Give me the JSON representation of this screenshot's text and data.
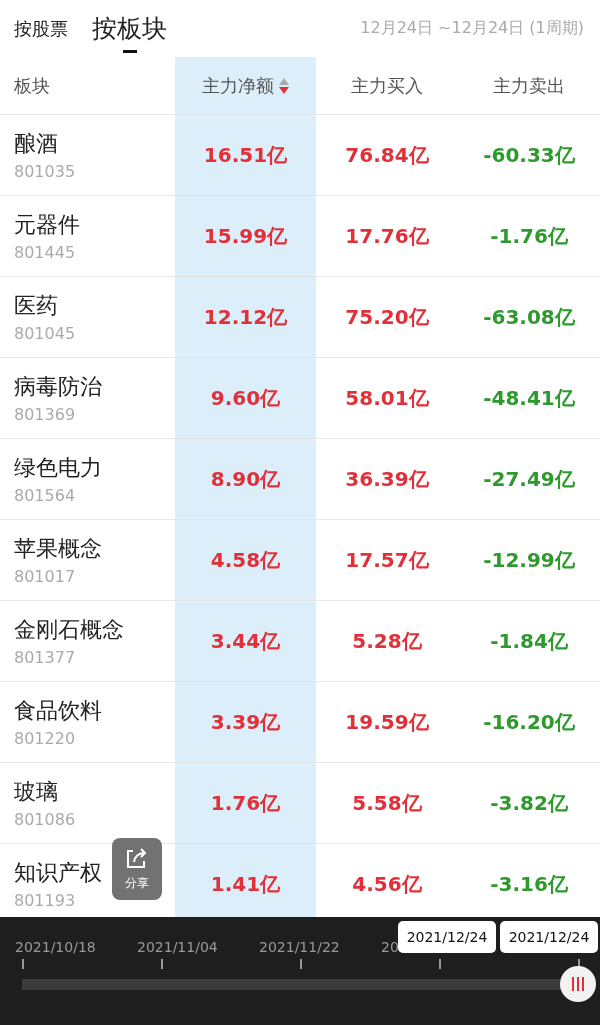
{
  "tabs": [
    {
      "label": "按股票",
      "selected": false
    },
    {
      "label": "按板块",
      "selected": true
    }
  ],
  "date_range": "12月24日 ~12月24日 (1周期)",
  "table": {
    "columns": [
      {
        "label": "板块",
        "selected": false,
        "sorted": false
      },
      {
        "label": "主力净额",
        "selected": true,
        "sorted": true
      },
      {
        "label": "主力买入",
        "selected": false,
        "sorted": false
      },
      {
        "label": "主力卖出",
        "selected": false,
        "sorted": false
      }
    ],
    "rows": [
      {
        "name": "酿酒",
        "code": "801035",
        "values": [
          {
            "text": "16.51亿",
            "color": "#e0313a"
          },
          {
            "text": "76.84亿",
            "color": "#e0313a"
          },
          {
            "text": "-60.33亿",
            "color": "#2e9a2e"
          }
        ]
      },
      {
        "name": "元器件",
        "code": "801445",
        "values": [
          {
            "text": "15.99亿",
            "color": "#e0313a"
          },
          {
            "text": "17.76亿",
            "color": "#e0313a"
          },
          {
            "text": "-1.76亿",
            "color": "#2e9a2e"
          }
        ]
      },
      {
        "name": "医药",
        "code": "801045",
        "values": [
          {
            "text": "12.12亿",
            "color": "#e0313a"
          },
          {
            "text": "75.20亿",
            "color": "#e0313a"
          },
          {
            "text": "-63.08亿",
            "color": "#2e9a2e"
          }
        ]
      },
      {
        "name": "病毒防治",
        "code": "801369",
        "values": [
          {
            "text": "9.60亿",
            "color": "#e0313a"
          },
          {
            "text": "58.01亿",
            "color": "#e0313a"
          },
          {
            "text": "-48.41亿",
            "color": "#2e9a2e"
          }
        ]
      },
      {
        "name": "绿色电力",
        "code": "801564",
        "values": [
          {
            "text": "8.90亿",
            "color": "#e0313a"
          },
          {
            "text": "36.39亿",
            "color": "#e0313a"
          },
          {
            "text": "-27.49亿",
            "color": "#2e9a2e"
          }
        ]
      },
      {
        "name": "苹果概念",
        "code": "801017",
        "values": [
          {
            "text": "4.58亿",
            "color": "#e0313a"
          },
          {
            "text": "17.57亿",
            "color": "#e0313a"
          },
          {
            "text": "-12.99亿",
            "color": "#2e9a2e"
          }
        ]
      },
      {
        "name": "金刚石概念",
        "code": "801377",
        "values": [
          {
            "text": "3.44亿",
            "color": "#e0313a"
          },
          {
            "text": "5.28亿",
            "color": "#e0313a"
          },
          {
            "text": "-1.84亿",
            "color": "#2e9a2e"
          }
        ]
      },
      {
        "name": "食品饮料",
        "code": "801220",
        "values": [
          {
            "text": "3.39亿",
            "color": "#e0313a"
          },
          {
            "text": "19.59亿",
            "color": "#e0313a"
          },
          {
            "text": "-16.20亿",
            "color": "#2e9a2e"
          }
        ]
      },
      {
        "name": "玻璃",
        "code": "801086",
        "values": [
          {
            "text": "1.76亿",
            "color": "#e0313a"
          },
          {
            "text": "5.58亿",
            "color": "#e0313a"
          },
          {
            "text": "-3.82亿",
            "color": "#2e9a2e"
          }
        ]
      },
      {
        "name": "知识产权",
        "code": "801193",
        "values": [
          {
            "text": "1.41亿",
            "color": "#e0313a"
          },
          {
            "text": "4.56亿",
            "color": "#e0313a"
          },
          {
            "text": "-3.16亿",
            "color": "#2e9a2e"
          }
        ]
      }
    ]
  },
  "share_button": {
    "label": "分享"
  },
  "timeline": {
    "labels": [
      "2021/10/18",
      "2021/11/04",
      "2021/11/22",
      "20"
    ],
    "tooltips": [
      "2021/12/24",
      "2021/12/24"
    ],
    "level": 1
  }
}
